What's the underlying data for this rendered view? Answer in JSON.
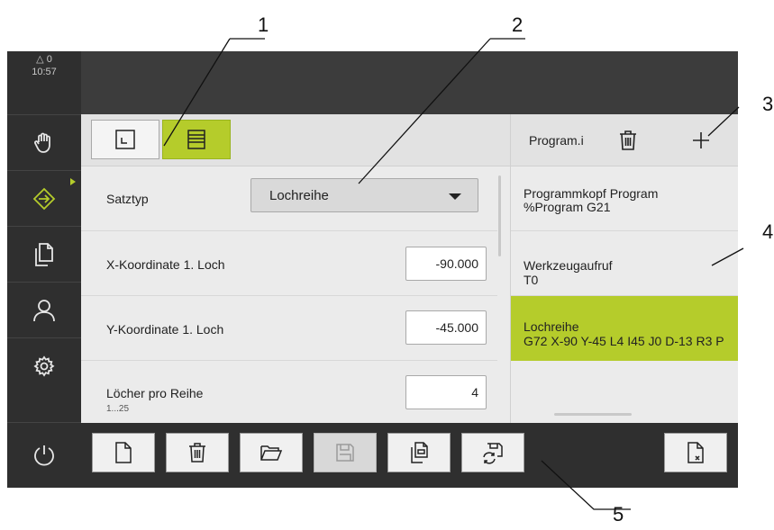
{
  "status": {
    "warning_count": "0",
    "time": "10:57"
  },
  "sidebar": {
    "items": [
      {
        "name": "manual-mode",
        "icon": "hand-icon"
      },
      {
        "name": "program",
        "icon": "program-arrow-icon",
        "active": true
      },
      {
        "name": "file-management",
        "icon": "files-icon"
      },
      {
        "name": "user-login",
        "icon": "user-icon"
      },
      {
        "name": "settings",
        "icon": "gear-icon"
      },
      {
        "name": "power",
        "icon": "power-icon"
      }
    ]
  },
  "form": {
    "satztyp_label": "Satztyp",
    "satztyp_value": "Lochreihe",
    "x_label": "X-Koordinate 1. Loch",
    "x_value": "-90.000",
    "y_label": "Y-Koordinate 1. Loch",
    "y_value": "-45.000",
    "loecher_label": "Löcher pro Reihe",
    "loecher_range": "1...25",
    "loecher_value": "4"
  },
  "program": {
    "title": "Program.i",
    "items": [
      {
        "name": "Programmkopf Program",
        "detail": "%Program G21"
      },
      {
        "name": "Werkzeugaufruf",
        "detail": "T0"
      },
      {
        "name": "Lochreihe",
        "detail": "G72 X-90 Y-45 L4 I45 J0 D-13 R3 P",
        "selected": true
      }
    ]
  },
  "toolbar": {
    "buttons": [
      "new-file-icon",
      "delete-icon",
      "open-folder-icon",
      "save-icon",
      "save-as-icon",
      "save-recovery-icon",
      "close-file-icon"
    ]
  },
  "callouts": [
    "1",
    "2",
    "3",
    "4",
    "5"
  ],
  "colors": {
    "accent": "#b5cc2b",
    "sidebar": "#2f2f2f",
    "header": "#3c3c3c",
    "panel": "#ebebeb"
  }
}
